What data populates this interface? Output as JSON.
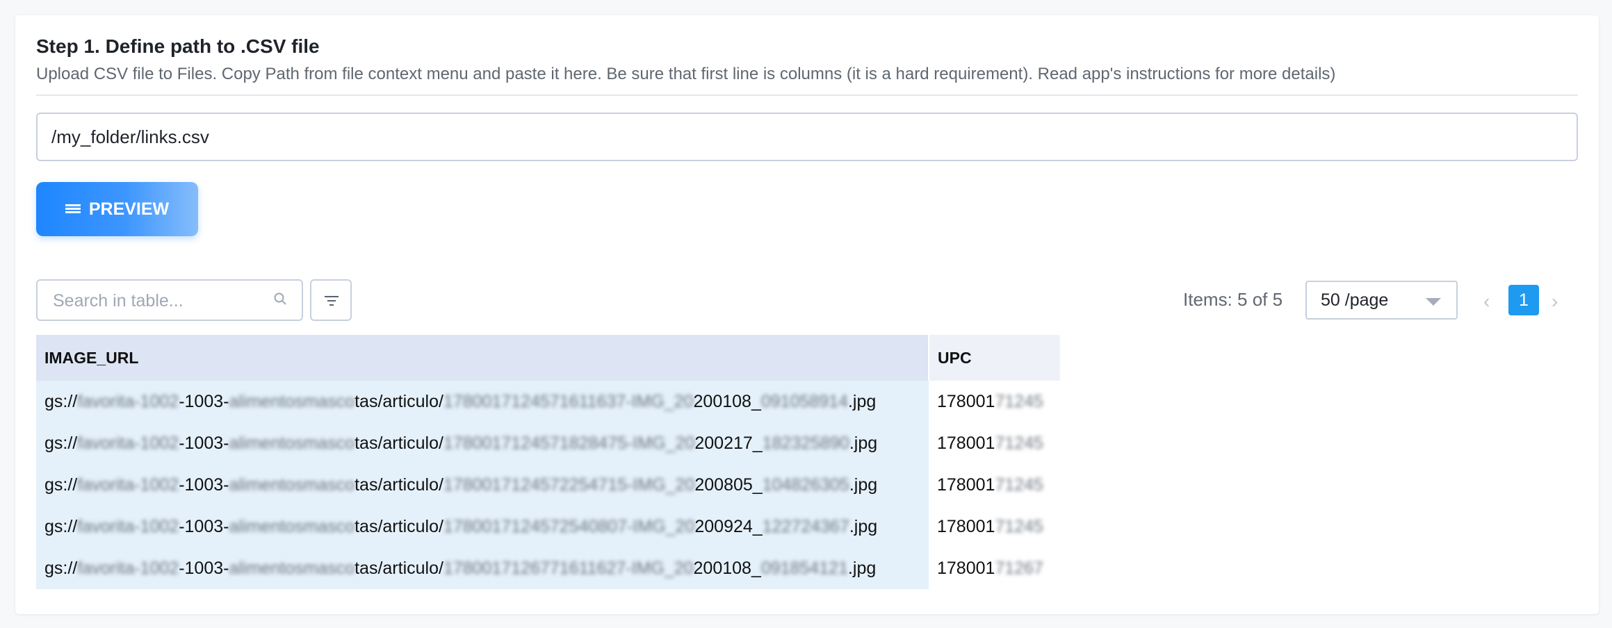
{
  "step": {
    "title": "Step 1. Define path to .CSV file",
    "description": "Upload CSV file to Files. Copy Path from file context menu and paste it here. Be sure that first line is columns (it is a hard requirement). Read app's instructions for more details)"
  },
  "path_input": {
    "value": "/my_folder/links.csv"
  },
  "preview_button": {
    "label": "PREVIEW",
    "icon": "list-icon"
  },
  "toolbar": {
    "search_placeholder": "Search in table...",
    "items_text": "Items: 5 of 5",
    "page_size": "50 /page",
    "current_page": "1"
  },
  "table": {
    "columns": [
      "IMAGE_URL",
      "UPC"
    ],
    "rows": [
      {
        "u1": "gs://",
        "u2": "favorita-1002",
        "u3": "-1003-",
        "u4": "alimentosmasco",
        "u5": "tas/articulo/",
        "u6": "1780017124571611637-IMG_20",
        "u7": "200108_",
        "u8": "091058914",
        "u9": ".jpg",
        "upc1": "178001",
        "upc2": "71245"
      },
      {
        "u1": "gs://",
        "u2": "favorita-1002",
        "u3": "-1003-",
        "u4": "alimentosmasco",
        "u5": "tas/articulo/",
        "u6": "1780017124571828475-IMG_20",
        "u7": "200217_",
        "u8": "182325890",
        "u9": ".jpg",
        "upc1": "178001",
        "upc2": "71245"
      },
      {
        "u1": "gs://",
        "u2": "favorita-1002",
        "u3": "-1003-",
        "u4": "alimentosmasco",
        "u5": "tas/articulo/",
        "u6": "1780017124572254715-IMG_20",
        "u7": "200805_",
        "u8": "104826305",
        "u9": ".jpg",
        "upc1": "178001",
        "upc2": "71245"
      },
      {
        "u1": "gs://",
        "u2": "favorita-1002",
        "u3": "-1003-",
        "u4": "alimentosmasco",
        "u5": "tas/articulo/",
        "u6": "1780017124572540807-IMG_20",
        "u7": "200924_",
        "u8": "122724367",
        "u9": ".jpg",
        "upc1": "178001",
        "upc2": "71245"
      },
      {
        "u1": "gs://",
        "u2": "favorita-1002",
        "u3": "-1003-",
        "u4": "alimentosmasco",
        "u5": "tas/articulo/",
        "u6": "1780017126771611627-IMG_20",
        "u7": "200108_",
        "u8": "091854121",
        "u9": ".jpg",
        "upc1": "178001",
        "upc2": "71267"
      }
    ]
  }
}
